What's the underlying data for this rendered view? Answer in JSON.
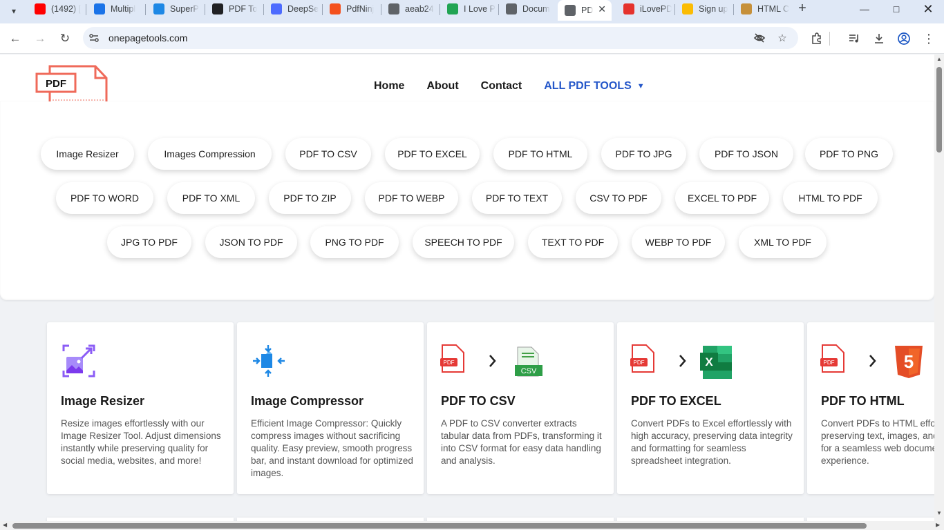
{
  "browser": {
    "tabs": [
      {
        "title": "(1492) [",
        "favicon": "youtube-icon",
        "color": "#ff0000"
      },
      {
        "title": "Multipl",
        "favicon": "app-icon",
        "color": "#1a73e8"
      },
      {
        "title": "SuperP",
        "favicon": "superpdf-icon",
        "color": "#1e88e5"
      },
      {
        "title": "PDF To",
        "favicon": "openai-icon",
        "color": "#202124"
      },
      {
        "title": "DeepSe",
        "favicon": "deepseek-icon",
        "color": "#4d6bfe"
      },
      {
        "title": "PdfNinj",
        "favicon": "pdfninja-icon",
        "color": "#f4511e"
      },
      {
        "title": "aeab24",
        "favicon": "globe-icon",
        "color": "#5f6368"
      },
      {
        "title": "I Love P",
        "favicon": "ilovepdf-icon",
        "color": "#21a453"
      },
      {
        "title": "Docum",
        "favicon": "globe-icon",
        "color": "#5f6368"
      },
      {
        "title": "PD",
        "favicon": "globe-icon",
        "color": "#5f6368",
        "active": true
      },
      {
        "title": "iLovePD",
        "favicon": "heart-icon",
        "color": "#e5322d"
      },
      {
        "title": "Sign up",
        "favicon": "google-ads-icon",
        "color": "#fbbc04"
      },
      {
        "title": "HTML C",
        "favicon": "notepad-icon",
        "color": "#c6903a"
      }
    ],
    "url": "onepagetools.com"
  },
  "header": {
    "logo_text": "PDF",
    "nav": [
      {
        "label": "Home"
      },
      {
        "label": "About"
      },
      {
        "label": "Contact"
      },
      {
        "label": "ALL PDF TOOLS"
      }
    ]
  },
  "tools": {
    "pills": [
      "Image Resizer",
      "Images Compression",
      "PDF TO CSV",
      "PDF TO EXCEL",
      "PDF TO HTML",
      "PDF TO JPG",
      "PDF TO JSON",
      "PDF TO PNG",
      "PDF TO WORD",
      "PDF TO XML",
      "PDF TO ZIP",
      "PDF TO WEBP",
      "PDF TO TEXT",
      "CSV TO PDF",
      "EXCEL TO PDF",
      "HTML TO PDF",
      "JPG TO PDF",
      "JSON TO PDF",
      "PNG TO PDF",
      "SPEECH TO PDF",
      "TEXT TO PDF",
      "WEBP TO PDF",
      "XML TO PDF"
    ]
  },
  "cards": [
    {
      "title": "Image Resizer",
      "desc": "Resize images effortlessly with our Image Resizer Tool. Adjust dimensions instantly while preserving quality for social media, websites, and more!",
      "icon": "image-resize-icon"
    },
    {
      "title": "Image Compressor",
      "desc": "Efficient Image Compressor: Quickly compress images without sacrificing quality. Easy preview, smooth progress bar, and instant download for optimized images.",
      "icon": "compress-icon"
    },
    {
      "title": "PDF TO CSV",
      "desc": "A PDF to CSV converter extracts tabular data from PDFs, transforming it into CSV format for easy data handling and analysis.",
      "icon": "pdf-to-csv-icon",
      "target_badge": "CSV"
    },
    {
      "title": "PDF TO EXCEL",
      "desc": "Convert PDFs to Excel effortlessly with high accuracy, preserving data integrity and formatting for seamless spreadsheet integration.",
      "icon": "pdf-to-excel-icon",
      "target_badge": "X"
    },
    {
      "title": "PDF TO HTML",
      "desc": "Convert PDFs to HTML effortlessly, preserving text, images, and formatting for a seamless web document experience.",
      "icon": "pdf-to-html-icon",
      "target_badge": "5"
    }
  ],
  "pdf_badge": "PDF"
}
